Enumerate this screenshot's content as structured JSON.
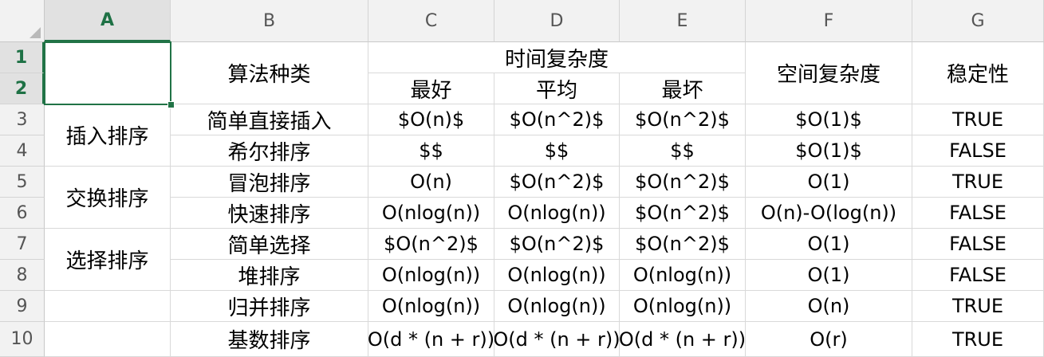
{
  "columns": [
    "A",
    "B",
    "C",
    "D",
    "E",
    "F",
    "G"
  ],
  "rows": [
    "1",
    "2",
    "3",
    "4",
    "5",
    "6",
    "7",
    "8",
    "9",
    "10"
  ],
  "active_cell": "A1",
  "accent_color": "#217346",
  "header": {
    "algorithm_type": "算法种类",
    "time_complexity": "时间复杂度",
    "best": "最好",
    "average": "平均",
    "worst": "最坏",
    "space_complexity": "空间复杂度",
    "stability": "稳定性"
  },
  "groups": [
    "插入排序",
    "交换排序",
    "选择排序"
  ],
  "table": [
    {
      "name": "简单直接插入",
      "best": "$O(n)$",
      "avg": "$O(n^2)$",
      "worst": "$O(n^2)$",
      "space": "$O(1)$",
      "stable": "TRUE"
    },
    {
      "name": "希尔排序",
      "best": "$$",
      "avg": "$$",
      "worst": "$$",
      "space": "$O(1)$",
      "stable": "FALSE"
    },
    {
      "name": "冒泡排序",
      "best": "O(n)",
      "avg": "$O(n^2)$",
      "worst": "$O(n^2)$",
      "space": "O(1)",
      "stable": "TRUE"
    },
    {
      "name": "快速排序",
      "best": "O(nlog(n))",
      "avg": "O(nlog(n))",
      "worst": "$O(n^2)$",
      "space": "O(n)-O(log(n))",
      "stable": "FALSE"
    },
    {
      "name": "简单选择",
      "best": "$O(n^2)$",
      "avg": "$O(n^2)$",
      "worst": "$O(n^2)$",
      "space": "O(1)",
      "stable": "FALSE"
    },
    {
      "name": "堆排序",
      "best": "O(nlog(n))",
      "avg": "O(nlog(n))",
      "worst": "O(nlog(n))",
      "space": "O(1)",
      "stable": "FALSE"
    },
    {
      "name": "归并排序",
      "best": "O(nlog(n))",
      "avg": "O(nlog(n))",
      "worst": "O(nlog(n))",
      "space": "O(n)",
      "stable": "TRUE"
    },
    {
      "name": "基数排序",
      "best": "O(d * (n + r))",
      "avg": "O(d * (n + r))",
      "worst": "O(d * (n + r))",
      "space": "O(r)",
      "stable": "TRUE"
    }
  ]
}
